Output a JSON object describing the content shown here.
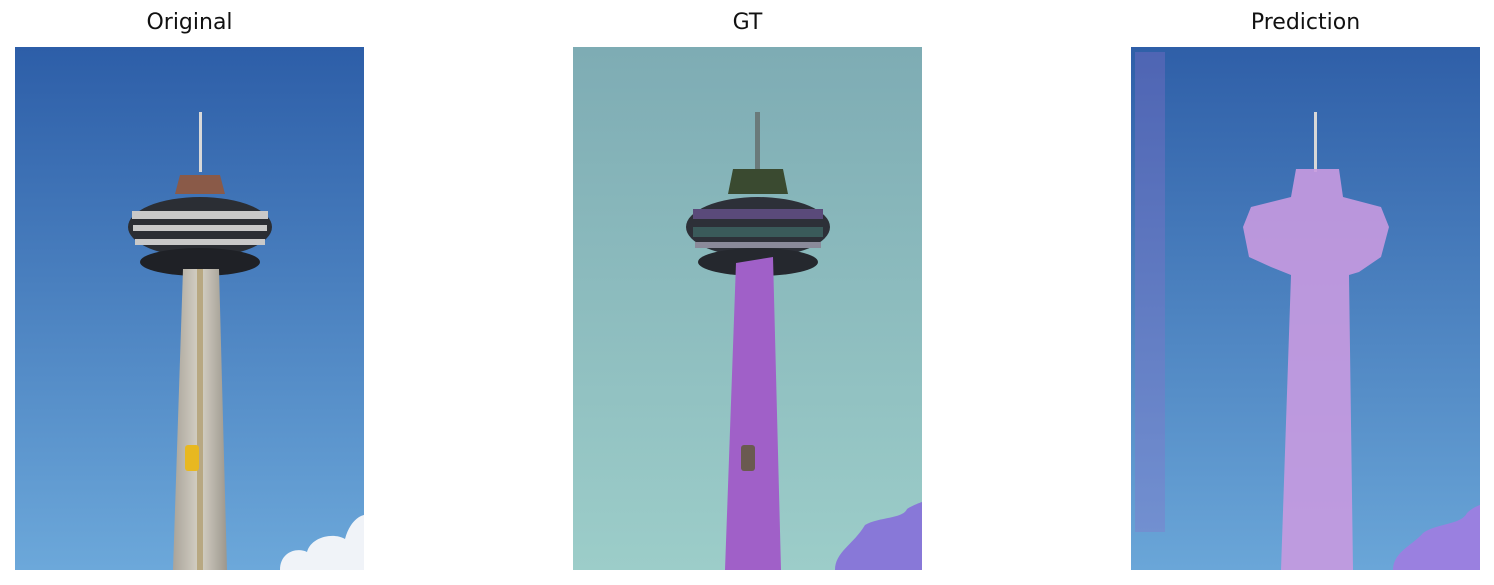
{
  "panels": [
    {
      "title": "Original"
    },
    {
      "title": "GT"
    },
    {
      "title": "Prediction"
    }
  ],
  "colors": {
    "sky_top": "#2f5fa8",
    "sky_bottom": "#6aa6d8",
    "gt_sky_top": "#7eacb4",
    "gt_sky_bottom": "#9ccdc9",
    "tower_shaft": "#c9c4ba",
    "tower_head": "#2a2d33",
    "gt_tower_mask": "#a060c8",
    "gt_cloud_mask": "#8878d8",
    "pred_tower_mask": "#c89ae0",
    "pred_cloud_mask": "#9a80e0",
    "elevator": "#e8b820"
  }
}
